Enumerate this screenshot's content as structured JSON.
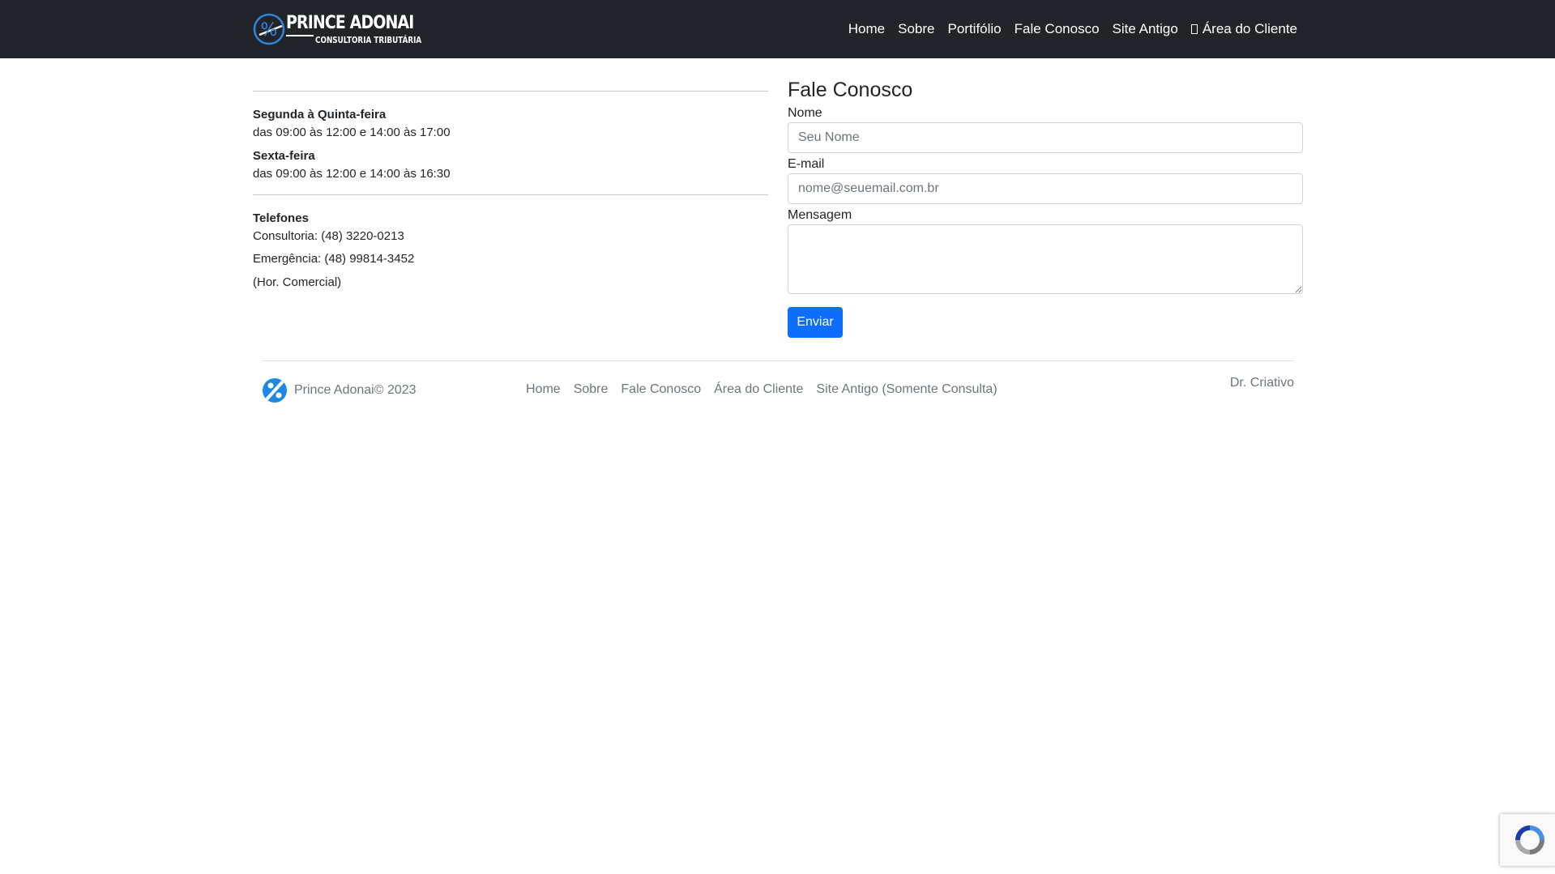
{
  "brand": {
    "title": "PRINCE ADONAI",
    "subtitle": "CONSULTORIA TRIBUTÁRIA",
    "logo_icon": "percent-circle-icon",
    "accent": "#2e86de"
  },
  "nav": {
    "items": [
      {
        "label": "Home"
      },
      {
        "label": "Sobre"
      },
      {
        "label": "Portifólio"
      },
      {
        "label": "Fale Conosco"
      },
      {
        "label": "Site Antigo"
      },
      {
        "label": "Área do Cliente",
        "icon": "user-box-icon"
      }
    ]
  },
  "info": {
    "schedule": [
      {
        "day": "Segunda à Quinta-feira",
        "hours": "das 09:00 às 12:00 e 14:00 às 17:00"
      },
      {
        "day": "Sexta-feira",
        "hours": "das 09:00 às 12:00 e 14:00 às 16:30"
      }
    ],
    "phones_title": "Telefones",
    "phones": [
      "Consultoria: (48) 3220-0213",
      "Emergência: (48) 99814-3452"
    ],
    "phones_note": "(Hor. Comercial)"
  },
  "form": {
    "title": "Fale Conosco",
    "name_label": "Nome",
    "name_placeholder": "Seu Nome",
    "email_label": "E-mail",
    "email_placeholder": "nome@seuemail.com.br",
    "message_label": "Mensagem",
    "submit_label": "Enviar",
    "submit_color": "#0d6efd"
  },
  "footer": {
    "copyright": "Prince Adonai© 2023",
    "links": [
      {
        "label": "Home"
      },
      {
        "label": "Sobre"
      },
      {
        "label": "Fale Conosco"
      },
      {
        "label": "Área do Cliente"
      },
      {
        "label": "Site Antigo (Somente Consulta)"
      }
    ],
    "credit": "Dr. Criativo"
  },
  "recaptcha": {
    "icon": "recaptcha-icon"
  }
}
